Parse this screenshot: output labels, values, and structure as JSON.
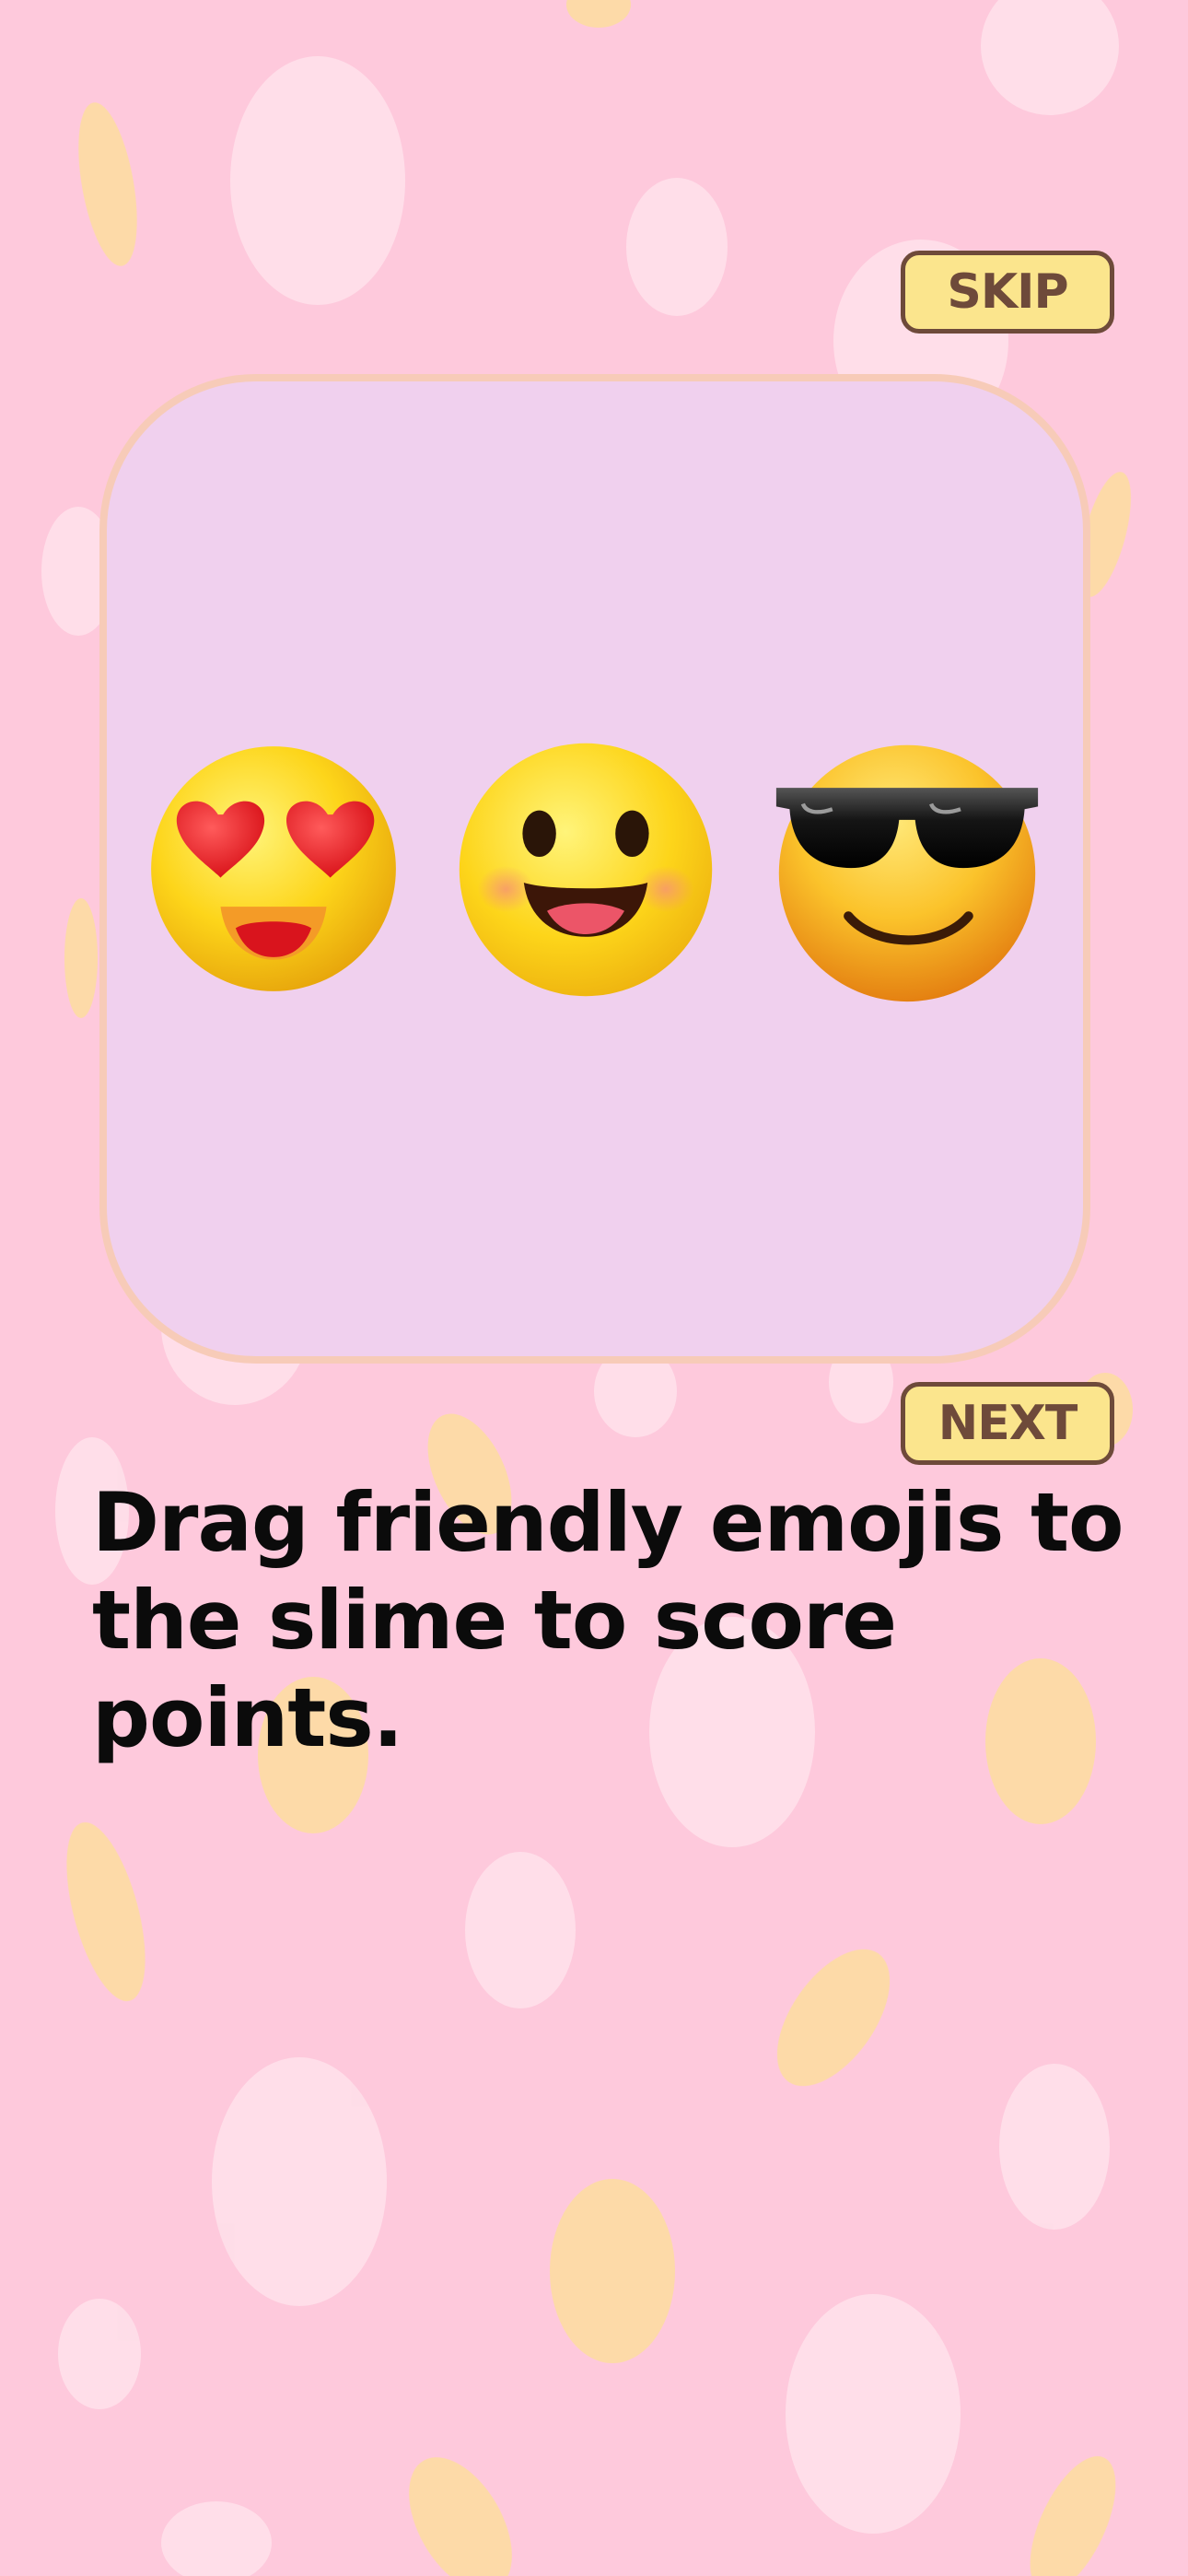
{
  "buttons": {
    "skip_label": "SKIP",
    "next_label": "NEXT"
  },
  "tutorial": {
    "emojis": [
      "heart-eyes-emoji",
      "smiling-face-emoji",
      "sunglasses-emoji"
    ],
    "instruction": "Drag friendly emojis to the slime to score points."
  },
  "colors": {
    "background": "#fec9dc",
    "card_fill": "#f0d0ee",
    "card_border": "#f7cbb8",
    "button_fill": "#fbe58d",
    "button_text": "#6e4a3a",
    "instruction_text": "#0b0b0b"
  }
}
